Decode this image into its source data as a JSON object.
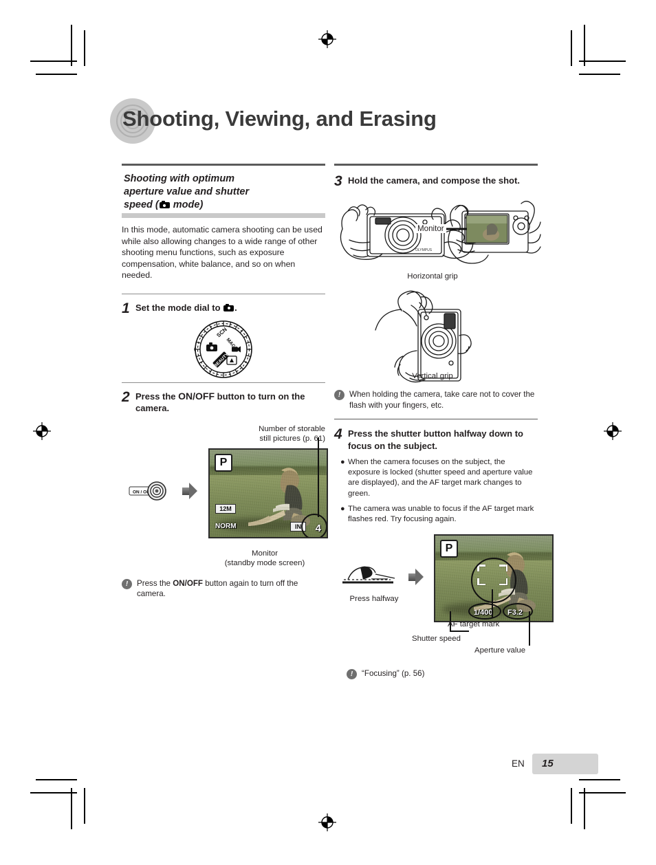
{
  "page": {
    "title": "Shooting, Viewing, and Erasing",
    "footer_lang": "EN",
    "footer_page": "15"
  },
  "left_column": {
    "section_heading_line1": "Shooting with optimum",
    "section_heading_line2": "aperture value and shutter",
    "section_heading_line3_pre": "speed (",
    "section_heading_line3_post": " mode)",
    "intro": "In this mode, automatic camera shooting can be used while also allowing changes to a wide range of other shooting menu functions, such as exposure compensation, white balance, and so on when needed.",
    "steps": [
      {
        "number": "1",
        "text_pre": "Set the mode dial to ",
        "text_post": ".",
        "figure": "mode-dial"
      },
      {
        "number": "2",
        "text_pre": "Press the ",
        "text_bold": "ON/OFF",
        "text_post": " button to turn on the camera."
      }
    ],
    "monitor_callout_line1": "Number of storable",
    "monitor_callout_line2": "still pictures (p. 61)",
    "onoff_button_label": "ON / OFF",
    "monitor_caption_line1": "Monitor",
    "monitor_caption_line2": "(standby mode screen)",
    "monitor_osd": {
      "mode": "P",
      "image_size": "12M",
      "compression": "NORM",
      "memory": "IN",
      "remaining": "4"
    },
    "note": {
      "icon": "exclamation-icon",
      "text_pre": "Press the ",
      "text_bold": "ON/OFF",
      "text_post": " button again to turn off the camera."
    }
  },
  "right_column": {
    "steps": [
      {
        "number": "3",
        "text": "Hold the camera, and compose the shot."
      },
      {
        "number": "4",
        "text": "Press the shutter button halfway down to focus on the subject."
      }
    ],
    "monitor_label": "Monitor",
    "horizontal_grip_caption": "Horizontal grip",
    "vertical_grip_caption": "Vertical grip",
    "note_grip": {
      "icon": "exclamation-icon",
      "text": "When holding the camera, take care not to cover the flash with your fingers, etc."
    },
    "bullets": [
      "When the camera focuses on the subject, the exposure is locked (shutter speed and aperture value are displayed), and the AF target mark changes to green.",
      "The camera was unable to focus if the AF target mark flashes red. Try focusing again."
    ],
    "press_halfway_caption": "Press halfway",
    "focus_monitor_osd": {
      "mode": "P",
      "shutter_speed": "1/400",
      "aperture": "F3.2"
    },
    "callouts": {
      "af_target": "AF target mark",
      "shutter_speed": "Shutter speed",
      "aperture_value": "Aperture value"
    },
    "note_focusing": {
      "icon": "exclamation-icon",
      "text": "“Focusing” (p. 56)"
    }
  },
  "colors": {
    "title_gray": "#3a3a3a",
    "rule_gray": "#5b5b5b",
    "heading_bar": "#c9c9c9",
    "footer_pill": "#d4d4d4",
    "note_icon": "#6f6f6f"
  }
}
